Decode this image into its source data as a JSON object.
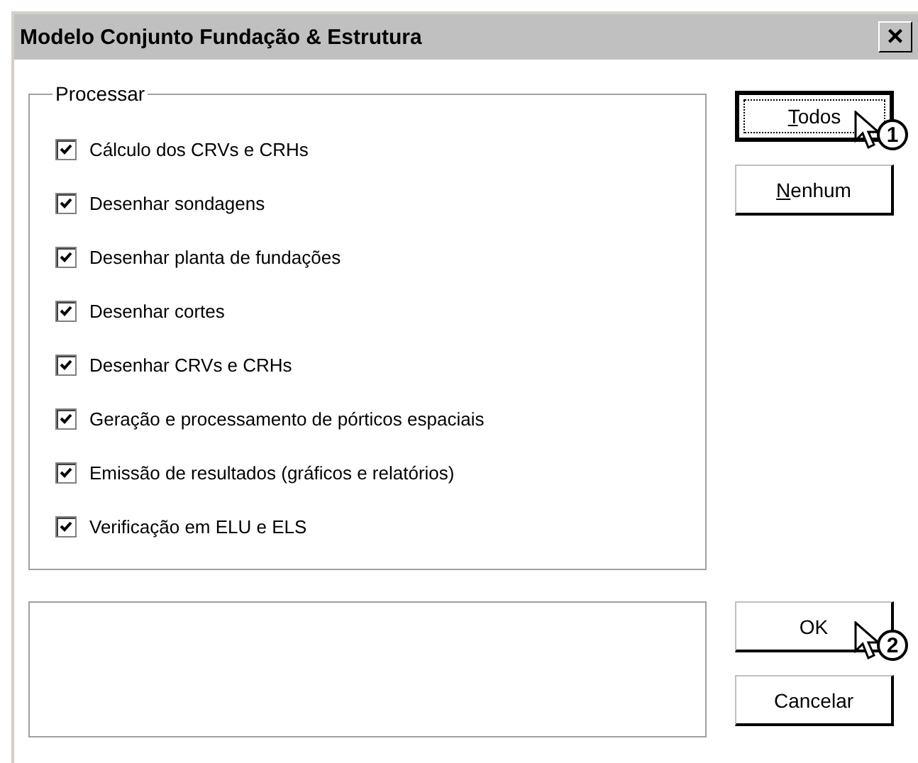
{
  "window": {
    "title": "Modelo Conjunto Fundação & Estrutura",
    "close": "×"
  },
  "group": {
    "label": "Processar",
    "options": [
      {
        "label": "Cálculo dos CRVs e CRHs",
        "checked": true
      },
      {
        "label": "Desenhar sondagens",
        "checked": true
      },
      {
        "label": "Desenhar planta de fundações",
        "checked": true
      },
      {
        "label": "Desenhar cortes",
        "checked": true
      },
      {
        "label": "Desenhar CRVs e CRHs",
        "checked": true
      },
      {
        "label": "Geração e processamento de pórticos espaciais",
        "checked": true
      },
      {
        "label": "Emissão de resultados (gráficos e relatórios)",
        "checked": true
      },
      {
        "label": "Verificação em ELU e ELS",
        "checked": true
      }
    ]
  },
  "select_buttons": [
    {
      "label": "Todos",
      "underline_first": true,
      "focused": true,
      "callout": "1"
    },
    {
      "label": "Nenhum",
      "underline_first": true,
      "focused": false
    }
  ],
  "dialog_buttons": [
    {
      "label": "OK",
      "underline_first": false,
      "focused": false,
      "callout": "2"
    },
    {
      "label": "Cancelar",
      "underline_first": false,
      "focused": false
    }
  ]
}
